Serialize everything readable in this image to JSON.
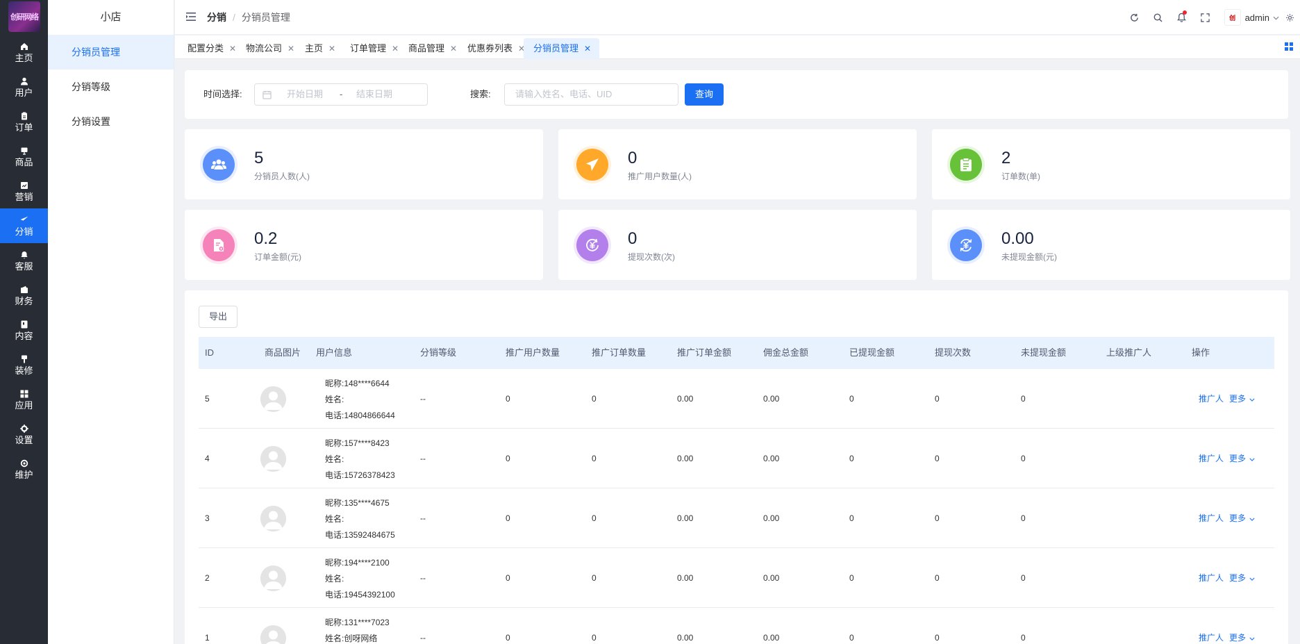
{
  "sidebar": {
    "logo_text": "创研网络",
    "items": [
      {
        "label": "主页",
        "icon": "home-icon"
      },
      {
        "label": "用户",
        "icon": "user-icon"
      },
      {
        "label": "订单",
        "icon": "order-icon"
      },
      {
        "label": "商品",
        "icon": "product-icon"
      },
      {
        "label": "营销",
        "icon": "marketing-icon"
      },
      {
        "label": "分销",
        "icon": "send-icon"
      },
      {
        "label": "客服",
        "icon": "bell-icon"
      },
      {
        "label": "财务",
        "icon": "finance-icon"
      },
      {
        "label": "内容",
        "icon": "content-icon"
      },
      {
        "label": "装修",
        "icon": "brush-icon"
      },
      {
        "label": "应用",
        "icon": "apps-icon"
      },
      {
        "label": "设置",
        "icon": "gear-icon"
      },
      {
        "label": "维护",
        "icon": "maintain-icon"
      }
    ],
    "active_index": 5
  },
  "subnav": {
    "shop_name": "小店",
    "items": [
      "分销员管理",
      "分销等级",
      "分销设置"
    ]
  },
  "header": {
    "breadcrumb_1": "分销",
    "breadcrumb_sep": "/",
    "breadcrumb_2": "分销员管理",
    "avatar_text": "创",
    "username": "admin"
  },
  "tabs": [
    "配置分类",
    "物流公司",
    "主页",
    "订单管理",
    "商品管理",
    "优惠券列表",
    "分销员管理"
  ],
  "search": {
    "time_label": "时间选择:",
    "start_placeholder": "开始日期",
    "date_sep": "-",
    "end_placeholder": "结束日期",
    "search_label": "搜索:",
    "search_placeholder": "请输入姓名、电话、UID",
    "query_button": "查询"
  },
  "stats": [
    {
      "value": "5",
      "label": "分销员人数(人)",
      "color": "#5b8ff9",
      "ring": "#e6eeff",
      "icon": "people-icon"
    },
    {
      "value": "0",
      "label": "推广用户数量(人)",
      "color": "#ffa82a",
      "ring": "#fff1dc",
      "icon": "paper-plane-icon"
    },
    {
      "value": "2",
      "label": "订单数(单)",
      "color": "#67c23a",
      "ring": "#e7f7dd",
      "icon": "clipboard-icon"
    },
    {
      "value": "0.2",
      "label": "订单金额(元)",
      "color": "#f582b8",
      "ring": "#fde8f2",
      "icon": "document-money-icon"
    },
    {
      "value": "0",
      "label": "提现次数(次)",
      "color": "#b37feb",
      "ring": "#f2e8fd",
      "icon": "withdraw-icon"
    },
    {
      "value": "0.00",
      "label": "未提现金额(元)",
      "color": "#5b8ff9",
      "ring": "#e6eeff",
      "icon": "yuan-refresh-icon"
    }
  ],
  "table": {
    "export_button": "导出",
    "columns": [
      "ID",
      "商品图片",
      "用户信息",
      "分销等级",
      "推广用户数量",
      "推广订单数量",
      "推广订单金额",
      "佣金总金额",
      "已提现金额",
      "提现次数",
      "未提现金额",
      "上级推广人",
      "操作"
    ],
    "rows": [
      {
        "id": "5",
        "nickname": "昵称:148****6644",
        "name": "姓名:",
        "phone": "电话:14804866644",
        "level": "--",
        "promo_users": "0",
        "promo_orders": "0",
        "promo_amount": "0.00",
        "commission": "0.00",
        "withdrawn": "0",
        "withdraw_times": "0",
        "unwithdrawn": "0",
        "parent": "",
        "action_1": "推广人",
        "action_2": "更多"
      },
      {
        "id": "4",
        "nickname": "昵称:157****8423",
        "name": "姓名:",
        "phone": "电话:15726378423",
        "level": "--",
        "promo_users": "0",
        "promo_orders": "0",
        "promo_amount": "0.00",
        "commission": "0.00",
        "withdrawn": "0",
        "withdraw_times": "0",
        "unwithdrawn": "0",
        "parent": "",
        "action_1": "推广人",
        "action_2": "更多"
      },
      {
        "id": "3",
        "nickname": "昵称:135****4675",
        "name": "姓名:",
        "phone": "电话:13592484675",
        "level": "--",
        "promo_users": "0",
        "promo_orders": "0",
        "promo_amount": "0.00",
        "commission": "0.00",
        "withdrawn": "0",
        "withdraw_times": "0",
        "unwithdrawn": "0",
        "parent": "",
        "action_1": "推广人",
        "action_2": "更多"
      },
      {
        "id": "2",
        "nickname": "昵称:194****2100",
        "name": "姓名:",
        "phone": "电话:19454392100",
        "level": "--",
        "promo_users": "0",
        "promo_orders": "0",
        "promo_amount": "0.00",
        "commission": "0.00",
        "withdrawn": "0",
        "withdraw_times": "0",
        "unwithdrawn": "0",
        "parent": "",
        "action_1": "推广人",
        "action_2": "更多"
      },
      {
        "id": "1",
        "nickname": "昵称:131****7023",
        "name": "姓名:创呀网络",
        "phone": "",
        "level": "--",
        "promo_users": "0",
        "promo_orders": "0",
        "promo_amount": "0.00",
        "commission": "0.00",
        "withdrawn": "0",
        "withdraw_times": "0",
        "unwithdrawn": "0",
        "parent": "",
        "action_1": "推广人",
        "action_2": "更多"
      }
    ]
  }
}
